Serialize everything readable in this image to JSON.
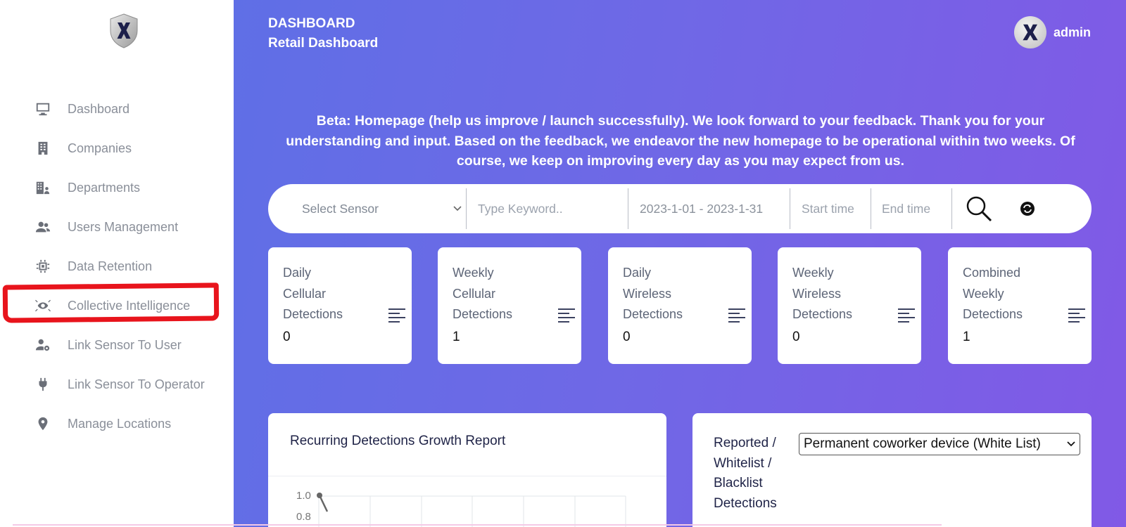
{
  "header": {
    "section": "DASHBOARD",
    "subtitle": "Retail Dashboard",
    "user": "admin"
  },
  "sidebar": {
    "items": [
      {
        "label": "Dashboard",
        "icon": "monitor-icon"
      },
      {
        "label": "Companies",
        "icon": "building-icon"
      },
      {
        "label": "Departments",
        "icon": "department-icon"
      },
      {
        "label": "Users Management",
        "icon": "users-icon"
      },
      {
        "label": "Data Retention",
        "icon": "chip-icon"
      },
      {
        "label": "Collective Intelligence",
        "icon": "eye-network-icon"
      },
      {
        "label": "Link Sensor To User",
        "icon": "user-gear-icon"
      },
      {
        "label": "Link Sensor To Operator",
        "icon": "plug-icon"
      },
      {
        "label": "Manage Locations",
        "icon": "location-pin-icon"
      }
    ],
    "highlight_color": "#e8141c"
  },
  "beta_notice": "Beta: Homepage (help us improve / launch successfully). We look forward to your feedback. Thank you for your understanding and input. Based on the feedback, we endeavor the new homepage to be operational within two weeks. Of course, we keep on improving every day as you may expect from us.",
  "filters": {
    "sensor_placeholder": "Select Sensor",
    "keyword_placeholder": "Type Keyword..",
    "date_range": "2023-1-01 - 2023-1-31",
    "start_time_placeholder": "Start time",
    "end_time_placeholder": "End time"
  },
  "stats": [
    {
      "l1": "Daily",
      "l2": "Cellular",
      "l3": "Detections",
      "value": "0"
    },
    {
      "l1": "Weekly",
      "l2": "Cellular",
      "l3": "Detections",
      "value": "1"
    },
    {
      "l1": "Daily",
      "l2": "Wireless",
      "l3": "Detections",
      "value": "0"
    },
    {
      "l1": "Weekly",
      "l2": "Wireless",
      "l3": "Detections",
      "value": "0"
    },
    {
      "l1": "Combined",
      "l2": "Weekly",
      "l3": "Detections",
      "value": "1"
    }
  ],
  "growth_report": {
    "title": "Recurring Detections Growth Report",
    "y_ticks": [
      "1.0",
      "0.8"
    ]
  },
  "list_panel": {
    "title_l1": "Reported /",
    "title_l2": "Whitelist /",
    "title_l3": "Blacklist",
    "title_l4": "Detections",
    "selected": "Permanent coworker device (White List)"
  },
  "colors": {
    "gradient_start": "#5f6fe6",
    "gradient_end": "#8159e6"
  }
}
